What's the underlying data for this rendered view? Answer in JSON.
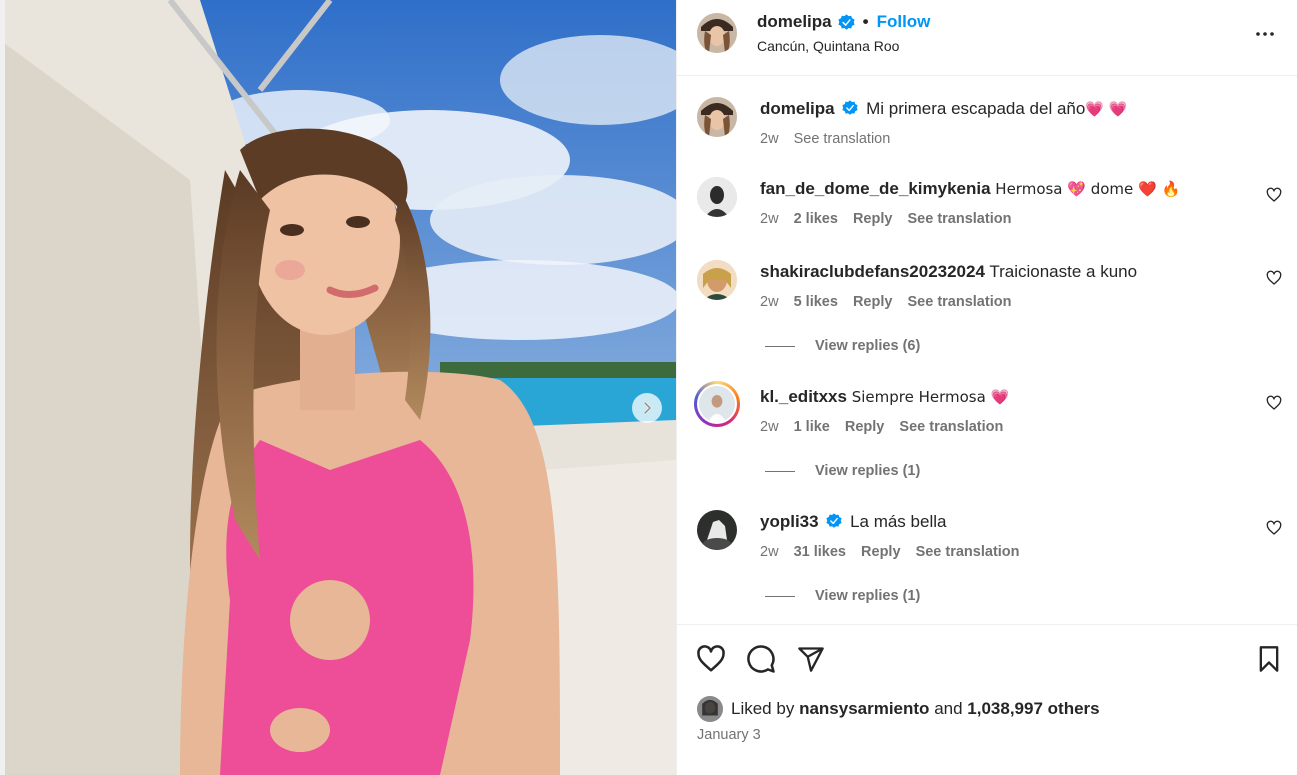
{
  "post": {
    "username": "domelipa",
    "follow_label": "Follow",
    "separator": "•",
    "location": "Cancún, Quintana Roo"
  },
  "caption": {
    "username": "domelipa",
    "text": "Mi primera escapada del año",
    "emoji": "💗 💗",
    "time": "2w",
    "see_translation": "See translation"
  },
  "comments": [
    {
      "username": "fan_de_dome_de_kimykenia",
      "text": "Hermosa 💖  dome ❤️ 🔥",
      "time": "2w",
      "likes": "2 likes",
      "reply": "Reply",
      "see_translation": "See translation"
    },
    {
      "username": "shakiraclubdefans20232024",
      "text": "Traicionaste a kuno",
      "time": "2w",
      "likes": "5 likes",
      "reply": "Reply",
      "see_translation": "See translation",
      "view_replies": "View replies (6)"
    },
    {
      "username": "kl._editxxs",
      "text": "Siempre Hermosa 💗",
      "time": "2w",
      "likes": "1 like",
      "reply": "Reply",
      "see_translation": "See translation",
      "view_replies": "View replies (1)"
    },
    {
      "username": "yopli33",
      "text": "La más bella",
      "time": "2w",
      "likes": "31 likes",
      "reply": "Reply",
      "see_translation": "See translation",
      "view_replies": "View replies (1)"
    }
  ],
  "footer": {
    "liked_by_prefix": "Liked by",
    "liked_by_user": "nansysarmiento",
    "and": "and",
    "others": "1,038,997 others",
    "date": "January 3"
  },
  "colors": {
    "accent": "#0095f6",
    "verified": "#0095f6",
    "secondary_text": "#737373"
  },
  "icons": {
    "like": "heart-icon",
    "comment": "comment-icon",
    "share": "send-icon",
    "save": "bookmark-icon",
    "more": "more-options-icon",
    "next": "chevron-right-icon"
  }
}
